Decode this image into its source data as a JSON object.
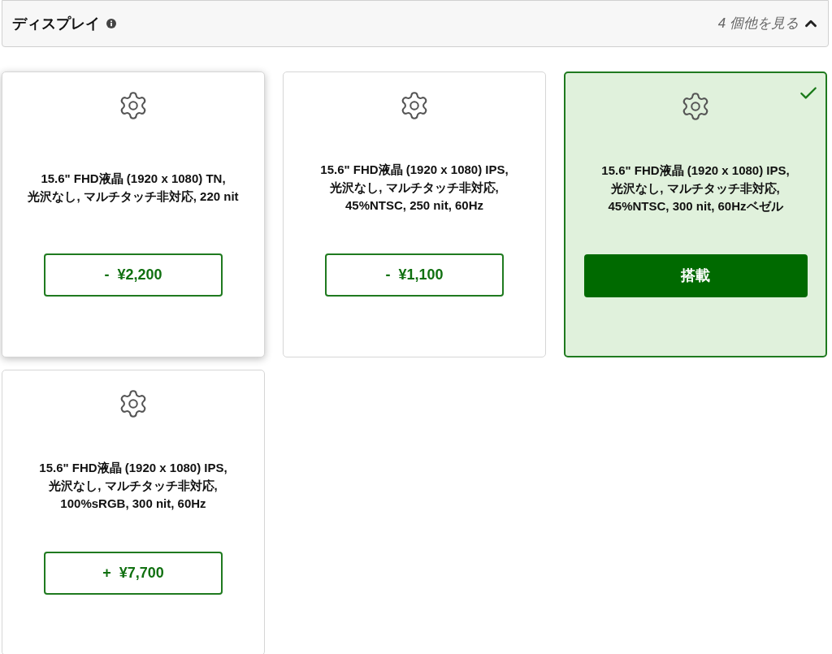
{
  "section": {
    "title": "ディスプレイ",
    "more_label": "4 個他を見る",
    "expanded": true
  },
  "options": [
    {
      "description": "15.6\" FHD液晶 (1920 x 1080) TN,\n光沢なし, マルチタッチ非対応, 220 nit",
      "price": "-  ¥2,200",
      "selected": false,
      "hovered": true
    },
    {
      "description": "15.6\" FHD液晶 (1920 x 1080) IPS,\n光沢なし, マルチタッチ非対応,\n45%NTSC, 250 nit, 60Hz",
      "price": "-  ¥1,100",
      "selected": false,
      "hovered": false
    },
    {
      "description": "15.6\" FHD液晶 (1920 x 1080) IPS,\n光沢なし, マルチタッチ非対応,\n45%NTSC, 300 nit, 60Hzベゼル",
      "price": "搭載",
      "selected": true,
      "hovered": false
    },
    {
      "description": "15.6\" FHD液晶 (1920 x 1080) IPS,\n光沢なし, マルチタッチ非対応,\n100%sRGB, 300 nit, 60Hz",
      "price": "+  ¥7,700",
      "selected": false,
      "hovered": false
    }
  ]
}
